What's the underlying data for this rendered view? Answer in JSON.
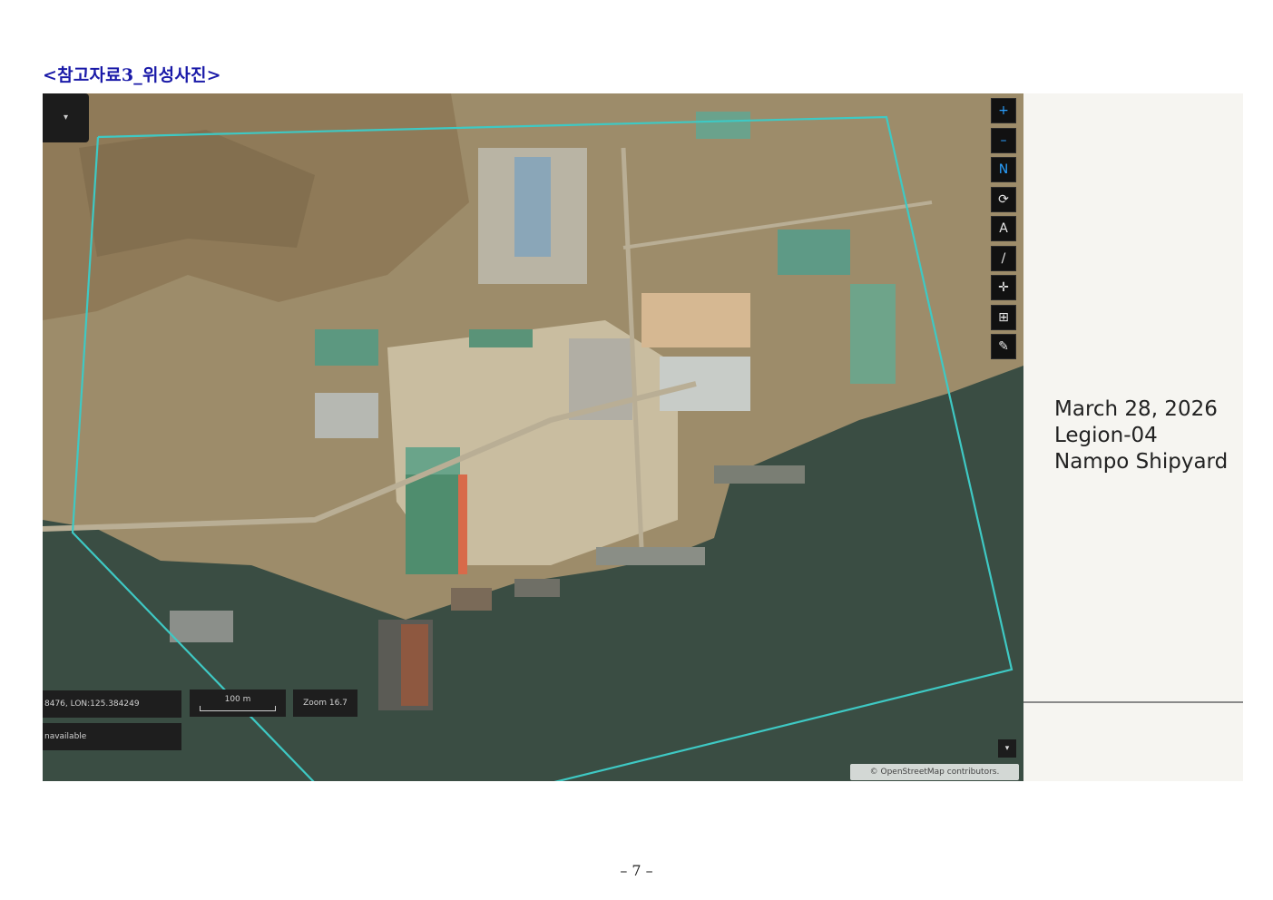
{
  "heading": "<참고자료3_위성사진>",
  "caption": {
    "date": "March 28, 2026",
    "satellite": "Legion-04",
    "location": "Nampo Shipyard"
  },
  "map": {
    "menu_label": "▾",
    "toolbar": {
      "zoom_in": "+",
      "zoom_out": "–",
      "north": "N",
      "rotate": "⟳",
      "labels": "A",
      "draw": "/",
      "crosshair": "✛",
      "grid": "⊞",
      "edit": "✎"
    },
    "coords_text": "8476, LON:125.384249",
    "scale_label": "100 m",
    "zoom_label": "Zoom 16.7",
    "availability_text": "navailable",
    "collapse_label": "▾",
    "attribution": "© OpenStreetMap contributors.",
    "colors": {
      "aoi_outline": "#3ec9c4",
      "water": "#344a40",
      "land": "#9a8a6a"
    }
  },
  "page_number": "– 7 –"
}
